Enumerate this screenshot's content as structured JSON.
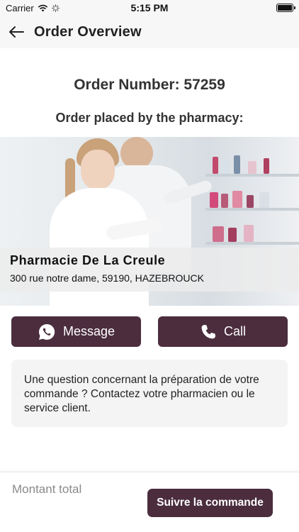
{
  "status_bar": {
    "carrier": "Carrier",
    "time": "5:15 PM"
  },
  "nav": {
    "title": "Order Overview",
    "back_icon": "arrow-left-icon"
  },
  "order": {
    "number_text": "Order Number: 57259",
    "placed_by_text": "Order placed by the pharmacy:"
  },
  "pharmacy": {
    "name": "Pharmacie De La Creule",
    "address": "300 rue notre dame, 59190, HAZEBROUCK"
  },
  "actions": {
    "message_label": "Message",
    "message_icon": "whatsapp-icon",
    "call_label": "Call",
    "call_icon": "phone-icon"
  },
  "info": {
    "text": "Une question concernant la préparation de votre commande ? Contactez votre pharmacien ou le service client."
  },
  "footer": {
    "total_label": "Montant total",
    "track_button": "Suivre la commande"
  },
  "colors": {
    "primary": "#4b2d3e",
    "info_bg": "#f4f4f4"
  }
}
